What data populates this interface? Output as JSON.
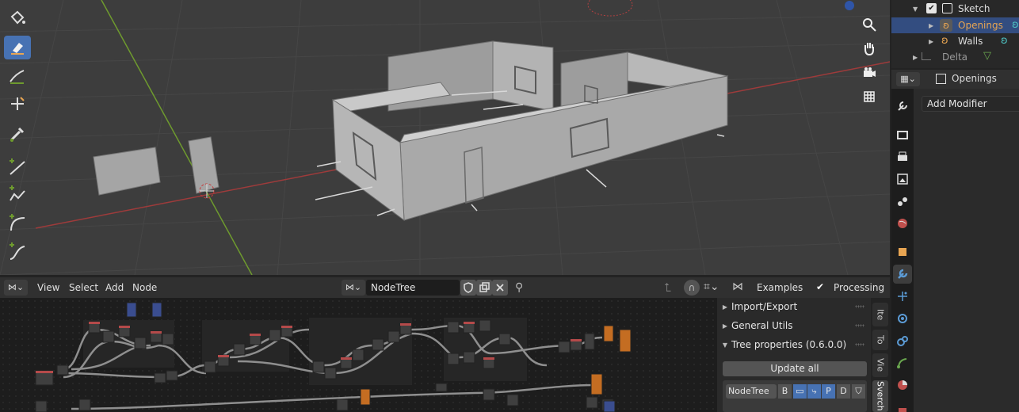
{
  "colors": {
    "accent": "#4772b3",
    "selected_row": "#334d80",
    "highlight_text": "#e8a552",
    "viewport_bg": "#3d3d3d",
    "x_axis": "#9e3b3b",
    "y_axis": "#6e9a2e",
    "wall": "#a9a9a9"
  },
  "viewport": {
    "tools": [
      "paint-bucket-icon",
      "eraser-icon",
      "draw-curve-icon",
      "transform-fill-icon",
      "eyedropper-icon",
      "line-icon",
      "polyline-icon",
      "arc-icon",
      "curve-icon"
    ],
    "active_tool": "eraser-icon",
    "nav": [
      "zoom-icon",
      "hand-icon",
      "camera-icon",
      "grid-icon"
    ]
  },
  "outliner": {
    "items": [
      {
        "label": "Sketch",
        "icon": "collection-icon",
        "expanded": true,
        "checked": true
      },
      {
        "label": "Openings",
        "icon": "grease-pencil-icon",
        "selected": true
      },
      {
        "label": "Walls",
        "icon": "grease-pencil-icon"
      },
      {
        "label": "Delta",
        "icon": "mesh-icon",
        "dimmed": true
      }
    ]
  },
  "properties": {
    "object_name": "Openings",
    "add_modifier": "Add Modifier",
    "tabs": [
      "tool-icon",
      "render-icon",
      "output-icon",
      "view-layer-icon",
      "scene-icon",
      "world-icon",
      "object-icon",
      "modifier-icon",
      "particles-icon",
      "physics-icon",
      "constraints-icon",
      "data-icon",
      "material-icon"
    ],
    "active_tab": "modifier-icon"
  },
  "node_editor": {
    "menu": [
      "View",
      "Select",
      "Add",
      "Node"
    ],
    "tree_name": "NodeTree",
    "examples_label": "Examples",
    "processing_label": "Processing",
    "processing_checked": true
  },
  "sidebar": {
    "panels": [
      {
        "label": "Import/Export",
        "expanded": false
      },
      {
        "label": "General Utils",
        "expanded": false
      },
      {
        "label": "Tree properties (0.6.0.0)",
        "expanded": true
      }
    ],
    "update_all": "Update all",
    "tree_row": {
      "name": "NodeTree",
      "b": "B",
      "p": "P",
      "d": "D"
    },
    "tabs": [
      "Ite",
      "To",
      "Vie",
      "Sverch"
    ],
    "active_tab": "Sverch"
  }
}
